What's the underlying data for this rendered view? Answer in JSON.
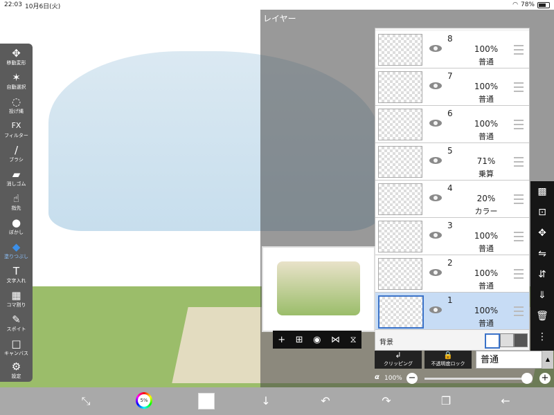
{
  "status": {
    "time": "22:03",
    "date": "10月6日(火)",
    "battery": "78%"
  },
  "toolbar": [
    {
      "icon": "move-icon",
      "glyph": "✥",
      "label": "移動変形"
    },
    {
      "icon": "magic-wand-icon",
      "glyph": "✶",
      "label": "自動選択"
    },
    {
      "icon": "lasso-icon",
      "glyph": "◌",
      "label": "投げ縄"
    },
    {
      "icon": "fx-icon",
      "glyph": "FX",
      "label": "フィルター"
    },
    {
      "icon": "brush-icon",
      "glyph": "/",
      "label": "ブラシ"
    },
    {
      "icon": "eraser-icon",
      "glyph": "▰",
      "label": "消しゴム"
    },
    {
      "icon": "finger-icon",
      "glyph": "☝",
      "label": "指先"
    },
    {
      "icon": "blur-icon",
      "glyph": "●",
      "label": "ぼかし"
    },
    {
      "icon": "fill-icon",
      "glyph": "◆",
      "label": "塗りつぶし"
    },
    {
      "icon": "text-icon",
      "glyph": "T",
      "label": "文字入れ"
    },
    {
      "icon": "frame-icon",
      "glyph": "▦",
      "label": "コマ割り"
    },
    {
      "icon": "eyedropper-icon",
      "glyph": "✎",
      "label": "スポイト"
    },
    {
      "icon": "canvas-icon",
      "glyph": "□",
      "label": "キャンバス"
    },
    {
      "icon": "gear-icon",
      "glyph": "⚙",
      "label": "設定"
    }
  ],
  "layer_panel": {
    "title": "レイヤー",
    "layers": [
      {
        "num": "8",
        "opacity": "100%",
        "mode": "普通"
      },
      {
        "num": "7",
        "opacity": "100%",
        "mode": "普通"
      },
      {
        "num": "6",
        "opacity": "100%",
        "mode": "普通"
      },
      {
        "num": "5",
        "opacity": "71%",
        "mode": "乗算"
      },
      {
        "num": "4",
        "opacity": "20%",
        "mode": "カラー"
      },
      {
        "num": "3",
        "opacity": "100%",
        "mode": "普通"
      },
      {
        "num": "2",
        "opacity": "100%",
        "mode": "普通"
      },
      {
        "num": "1",
        "opacity": "100%",
        "mode": "普通"
      }
    ],
    "background_label": "背景",
    "clipping_label": "クリッピング",
    "alpha_lock_label": "不透明度ロック",
    "blend_mode": "普通",
    "alpha_symbol": "α",
    "alpha_value": "100%"
  },
  "preview_toolbar": [
    "+",
    "⊞",
    "◉",
    "⋈",
    "⧖"
  ],
  "side_tools": [
    "▩",
    "⊡",
    "✥",
    "⇋",
    "⇵",
    "⇓",
    "🗑",
    "⋮"
  ],
  "bottom": {
    "brush_size": "5%"
  }
}
